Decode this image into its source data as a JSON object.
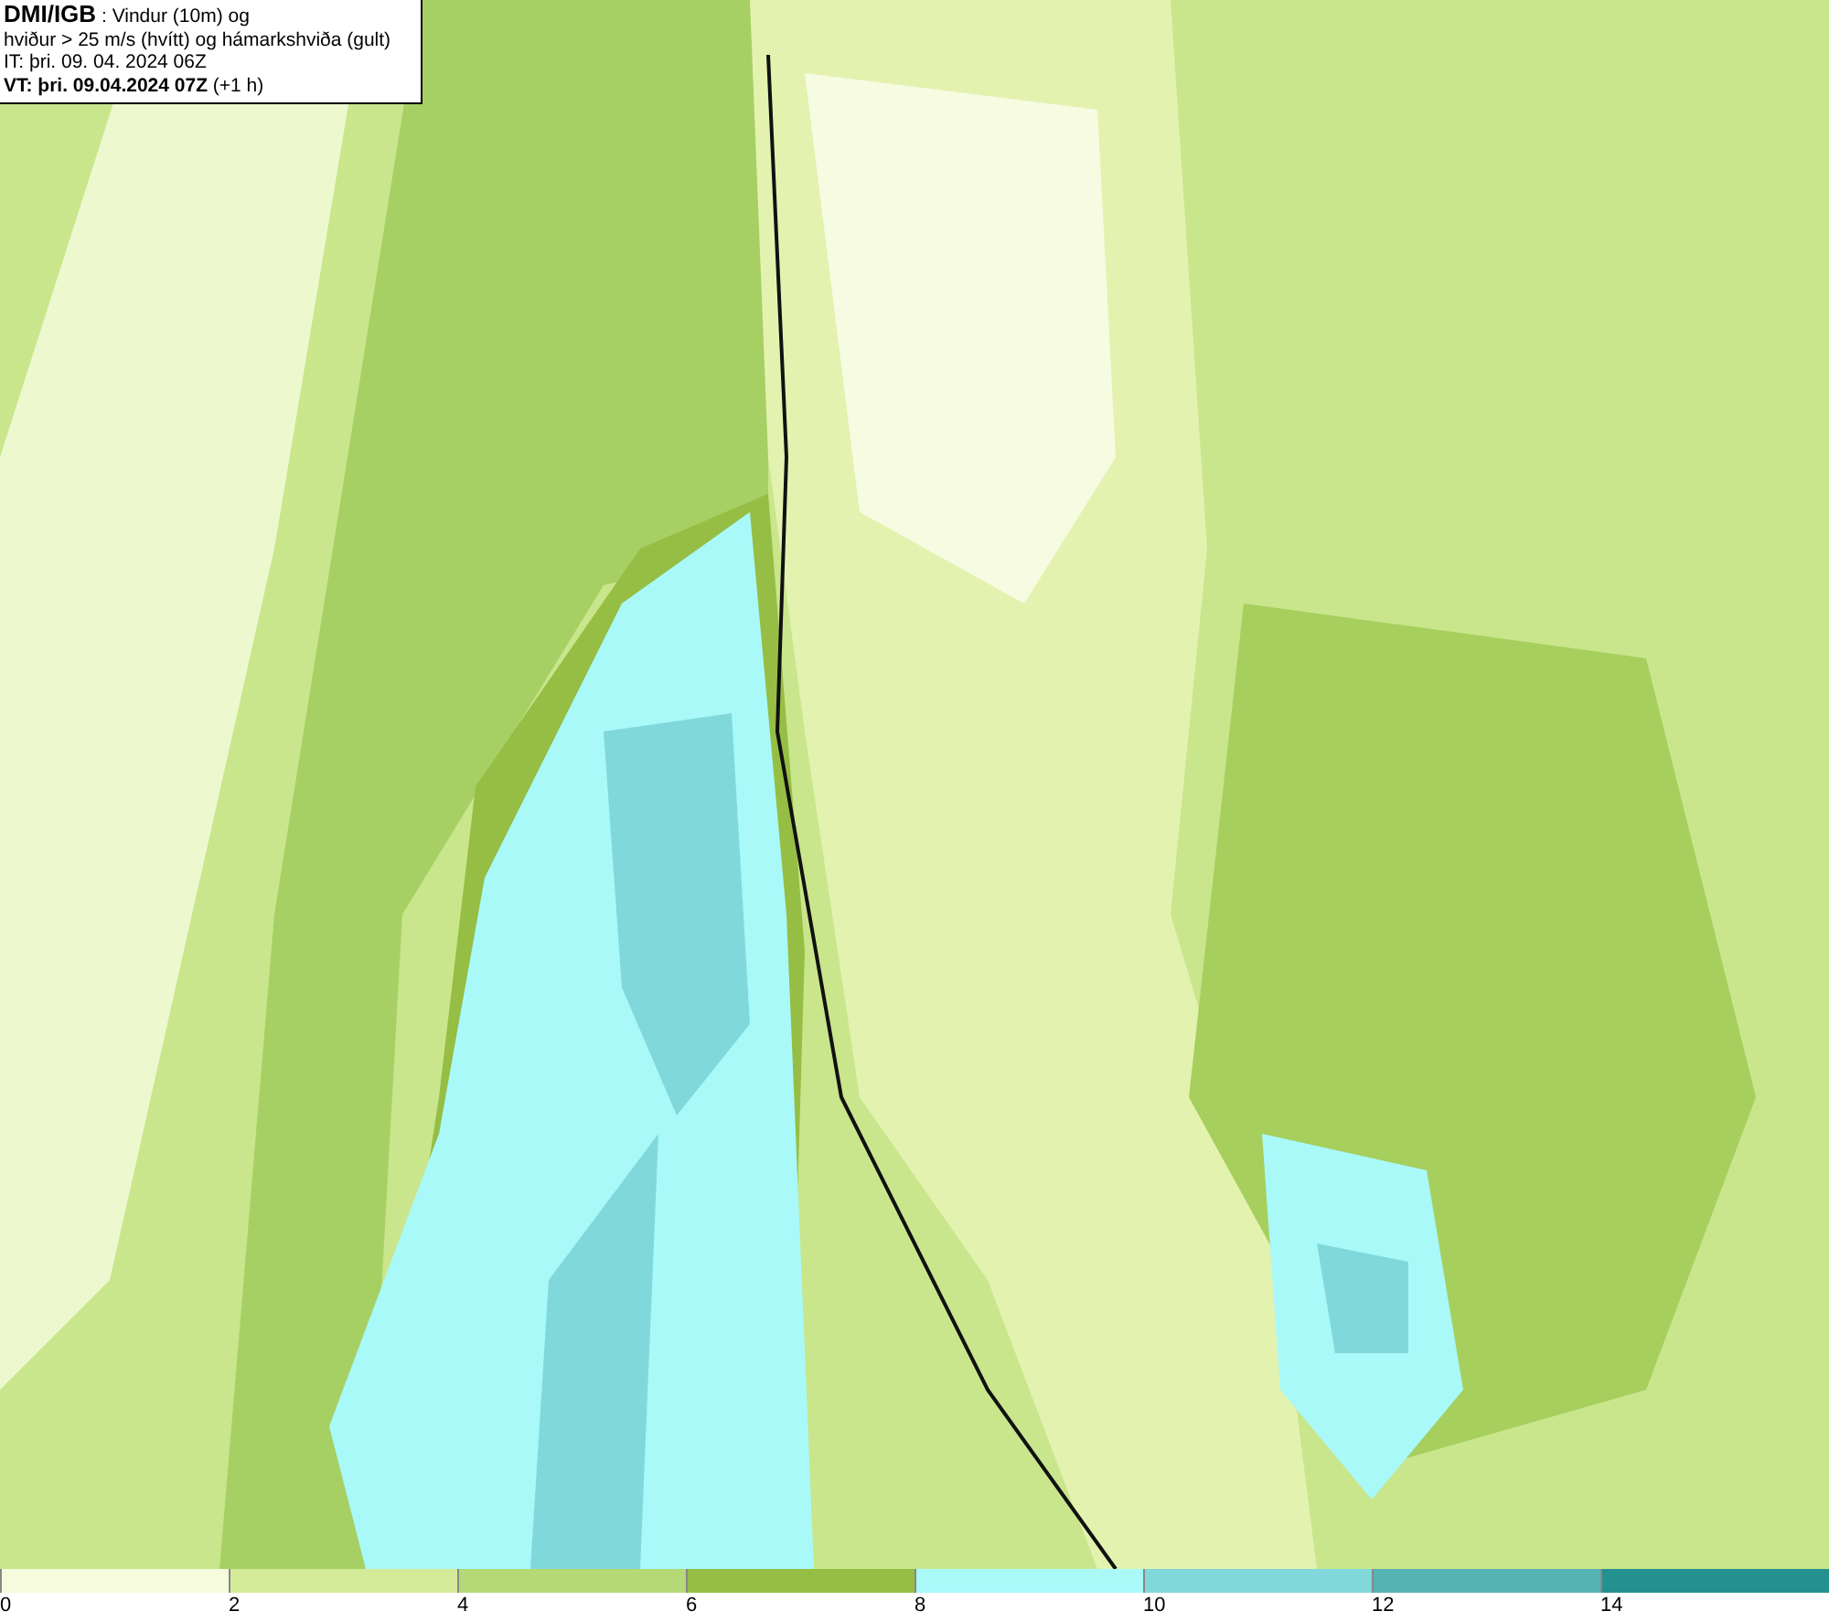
{
  "title_box": {
    "lines": [
      "**DMI/IGB** : Vindur (10m) og",
      "hviður > 25 m/s (hvítt) og hámarkshviða (gult)",
      "IT: þri. 09. 04. 2024 06Z",
      "**VT: þri. 09.04.2024 07Z** (+1 h)"
    ]
  },
  "legend": {
    "bins": [
      {
        "label": "0",
        "color": "#f5fbdc"
      },
      {
        "label": "2",
        "color": "#d4ec9a"
      },
      {
        "label": "4",
        "color": "#b5d977"
      },
      {
        "label": "6",
        "color": "#96be45"
      },
      {
        "label": "8",
        "color": "#a9f9f9"
      },
      {
        "label": "10",
        "color": "#80d8da"
      },
      {
        "label": "12",
        "color": "#55b3b3"
      },
      {
        "label": "14",
        "color": "#249090"
      }
    ]
  }
}
